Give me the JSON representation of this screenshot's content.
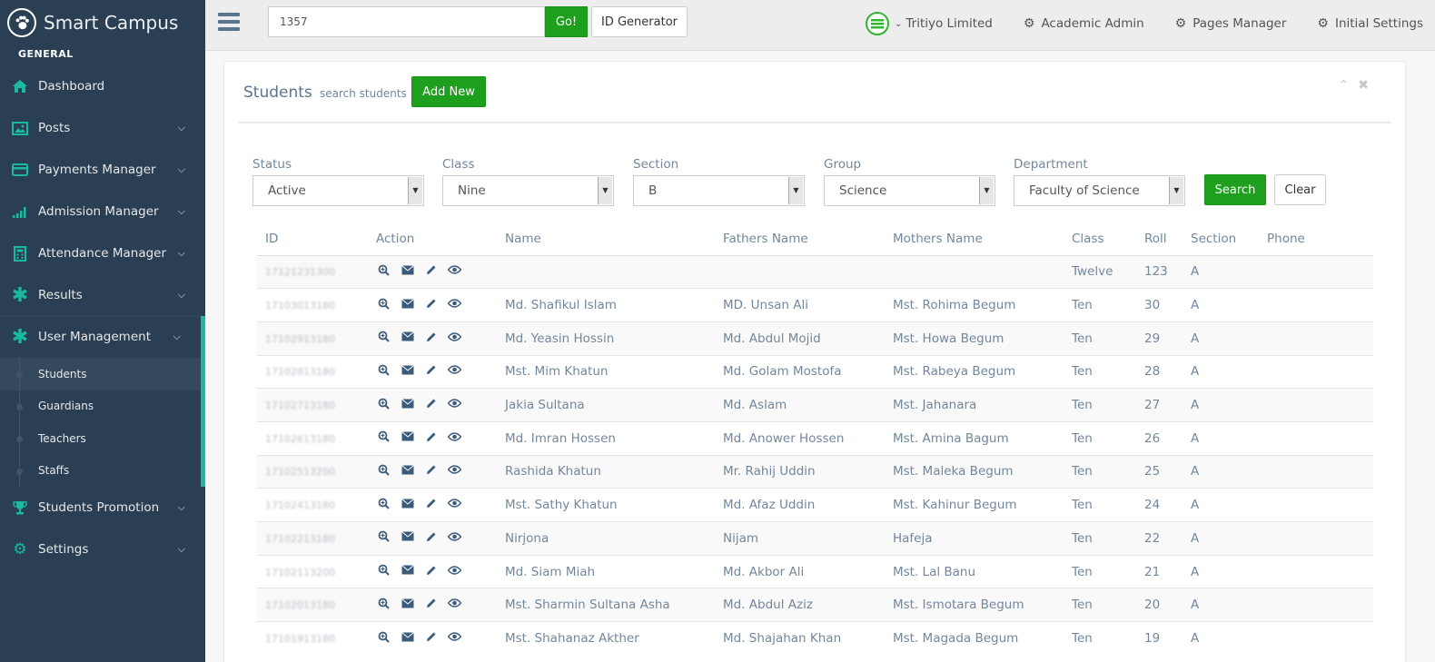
{
  "app": {
    "title": "Smart Campus"
  },
  "sidebar": {
    "section": "GENERAL",
    "items": [
      {
        "label": "Dashboard",
        "icon": "home-icon",
        "has_children": false
      },
      {
        "label": "Posts",
        "icon": "image-icon",
        "has_children": true
      },
      {
        "label": "Payments Manager",
        "icon": "credit-card-icon",
        "has_children": true
      },
      {
        "label": "Admission Manager",
        "icon": "signal-icon",
        "has_children": true
      },
      {
        "label": "Attendance Manager",
        "icon": "calculator-icon",
        "has_children": true
      },
      {
        "label": "Results",
        "icon": "asterisk-icon",
        "has_children": true
      },
      {
        "label": "User Management",
        "icon": "asterisk-icon",
        "has_children": true,
        "open": true
      },
      {
        "label": "Students Promotion",
        "icon": "trophy-icon",
        "has_children": true
      },
      {
        "label": "Settings",
        "icon": "gears-icon",
        "has_children": true
      }
    ],
    "user_management_children": [
      "Students",
      "Guardians",
      "Teachers",
      "Staffs"
    ]
  },
  "topnav": {
    "search_value": "1357",
    "go_label": "Go!",
    "id_generator_label": "ID Generator",
    "org_name": "Tritiyo Limited",
    "links": [
      "Academic Admin",
      "Pages Manager",
      "Initial Settings"
    ]
  },
  "panel": {
    "title": "Students",
    "subtitle": "search students",
    "add_new_label": "Add New"
  },
  "filters": [
    {
      "label": "Status",
      "value": "Active"
    },
    {
      "label": "Class",
      "value": "Nine"
    },
    {
      "label": "Section",
      "value": "B"
    },
    {
      "label": "Group",
      "value": "Science"
    },
    {
      "label": "Department",
      "value": "Faculty of Science"
    }
  ],
  "buttons": {
    "search": "Search",
    "clear": "Clear"
  },
  "table": {
    "columns": [
      "ID",
      "Action",
      "Name",
      "Fathers Name",
      "Mothers Name",
      "Class",
      "Roll",
      "Section",
      "Phone"
    ],
    "rows": [
      {
        "id": "17121231300",
        "name": "",
        "father": "",
        "mother": "",
        "class": "Twelve",
        "roll": "123",
        "section": "A",
        "phone": ""
      },
      {
        "id": "17103013180",
        "name": "Md. Shafikul Islam",
        "father": "MD. Unsan Ali",
        "mother": "Mst. Rohima Begum",
        "class": "Ten",
        "roll": "30",
        "section": "A",
        "phone": ""
      },
      {
        "id": "17102913180",
        "name": "Md. Yeasin Hossin",
        "father": "Md. Abdul Mojid",
        "mother": "Mst. Howa Begum",
        "class": "Ten",
        "roll": "29",
        "section": "A",
        "phone": ""
      },
      {
        "id": "17102813180",
        "name": "Mst. Mim Khatun",
        "father": "Md. Golam Mostofa",
        "mother": "Mst. Rabeya Begum",
        "class": "Ten",
        "roll": "28",
        "section": "A",
        "phone": ""
      },
      {
        "id": "17102713180",
        "name": "Jakia Sultana",
        "father": "Md. Aslam",
        "mother": "Mst. Jahanara",
        "class": "Ten",
        "roll": "27",
        "section": "A",
        "phone": ""
      },
      {
        "id": "17102613180",
        "name": "Md. Imran Hossen",
        "father": "Md. Anower Hossen",
        "mother": "Mst. Amina Bagum",
        "class": "Ten",
        "roll": "26",
        "section": "A",
        "phone": ""
      },
      {
        "id": "17102513200",
        "name": "Rashida Khatun",
        "father": "Mr. Rahij Uddin",
        "mother": "Mst. Maleka Begum",
        "class": "Ten",
        "roll": "25",
        "section": "A",
        "phone": ""
      },
      {
        "id": "17102413180",
        "name": "Mst. Sathy Khatun",
        "father": "Md. Afaz Uddin",
        "mother": "Mst. Kahinur Begum",
        "class": "Ten",
        "roll": "24",
        "section": "A",
        "phone": ""
      },
      {
        "id": "17102213180",
        "name": "Nirjona",
        "father": "Nijam",
        "mother": "Hafeja",
        "class": "Ten",
        "roll": "22",
        "section": "A",
        "phone": ""
      },
      {
        "id": "17102113200",
        "name": "Md. Siam Miah",
        "father": "Md. Akbor Ali",
        "mother": "Mst. Lal Banu",
        "class": "Ten",
        "roll": "21",
        "section": "A",
        "phone": ""
      },
      {
        "id": "17102013180",
        "name": "Mst. Sharmin Sultana Asha",
        "father": "Md. Abdul Aziz",
        "mother": "Mst. Ismotara Begum",
        "class": "Ten",
        "roll": "20",
        "section": "A",
        "phone": ""
      },
      {
        "id": "17101913180",
        "name": "Mst. Shahanaz Akther",
        "father": "Md. Shajahan Khan",
        "mother": "Mst. Magada Begum",
        "class": "Ten",
        "roll": "19",
        "section": "A",
        "phone": ""
      }
    ]
  },
  "colors": {
    "sidebar_bg": "#2A3F54",
    "accent": "#1ABB9C",
    "primary_green": "#1EA01E"
  }
}
